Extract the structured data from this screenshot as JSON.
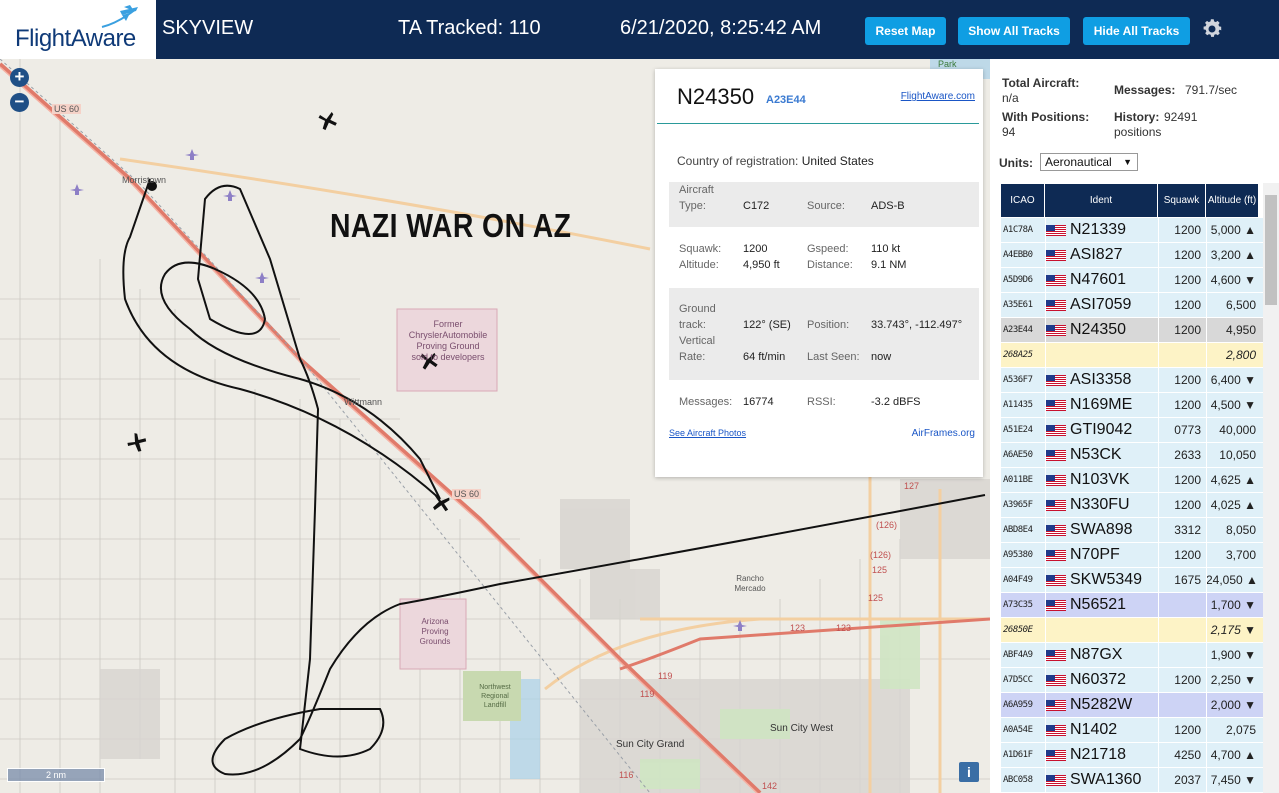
{
  "header": {
    "logo": "FlightAware",
    "app_title": "SKYVIEW",
    "tracked": "TA Tracked: 110",
    "clock": "6/21/2020, 8:25:42 AM",
    "buttons": {
      "reset": "Reset Map",
      "show": "Show All Tracks",
      "hide": "Hide All Tracks"
    }
  },
  "map": {
    "zoom_in": "+",
    "zoom_out": "−",
    "overlay_text": "NAZI WAR ON AZ",
    "scale": "2 nm",
    "info": "i",
    "labels": {
      "us60_a": "US 60",
      "us60_b": "US 60",
      "morristown": "Morristown",
      "wittmann": "Wittmann",
      "chrysler": "Former ChryslerAutomobile Proving Ground sold to developers",
      "arizona_pg": "Arizona Proving Grounds",
      "landfill": "Northwest Regional Landfill",
      "rancho": "Rancho Mercado",
      "sun_city_grand": "Sun City Grand",
      "sun_city_west": "Sun City West",
      "park": "Park",
      "r119a": "119",
      "r119b": "119",
      "r123a": "123",
      "r123b": "123",
      "r125a": "125",
      "r125b": "125",
      "r126a": "(126)",
      "r126b": "(126)",
      "r127": "127",
      "r116": "116",
      "r142": "142"
    }
  },
  "detail": {
    "ident": "N24350",
    "icao": "A23E44",
    "link": "FlightAware.com",
    "country_label": "Country of registration:",
    "country": "United States",
    "aircraft_type_label_1": "Aircraft",
    "aircraft_type_label_2": "Type:",
    "aircraft_type": "C172",
    "source_label": "Source:",
    "source": "ADS-B",
    "squawk_label": "Squawk:",
    "squawk": "1200",
    "altitude_label": "Altitude:",
    "altitude": "4,950 ft",
    "gspeed_label": "Gspeed:",
    "gspeed": "110 kt",
    "distance_label": "Distance:",
    "distance": "9.1 NM",
    "ground_label_1": "Ground",
    "ground_label_2": "track:",
    "ground_track": "122° (SE)",
    "vert_label_1": "Vertical",
    "vert_label_2": "Rate:",
    "vert_rate": "64 ft/min",
    "position_label": "Position:",
    "position": "33.743°, -112.497°",
    "last_seen_label": "Last Seen:",
    "last_seen": "now",
    "messages_label": "Messages:",
    "messages": "16774",
    "rssi_label": "RSSI:",
    "rssi": "-3.2 dBFS",
    "photos": "See Aircraft Photos",
    "airframes": "AirFrames.org"
  },
  "panel": {
    "total_label": "Total Aircraft:",
    "total": "n/a",
    "messages_label": "Messages:",
    "messages": "791.7/sec",
    "positions_label": "With Positions:",
    "positions": "94",
    "history_label": "History:",
    "history_value": "92491",
    "history_unit": "positions",
    "units_label": "Units:",
    "units": "Aeronautical",
    "columns": [
      "ICAO",
      "Ident",
      "Squawk",
      "Altitude (ft)"
    ],
    "rows": [
      {
        "icao": "A1C78A",
        "flag": true,
        "ident": "N21339",
        "squawk": "1200",
        "alt": "5,000 ▲",
        "bg": "#dff0f8"
      },
      {
        "icao": "A4EBB0",
        "flag": true,
        "ident": "ASI827",
        "squawk": "1200",
        "alt": "3,200 ▲",
        "bg": "#dff0f8"
      },
      {
        "icao": "A5D9D6",
        "flag": true,
        "ident": "N47601",
        "squawk": "1200",
        "alt": "4,600 ▼",
        "bg": "#dff0f8"
      },
      {
        "icao": "A35E61",
        "flag": true,
        "ident": "ASI7059",
        "squawk": "1200",
        "alt": "6,500",
        "bg": "#dff0f8"
      },
      {
        "icao": "A23E44",
        "flag": true,
        "ident": "N24350",
        "squawk": "1200",
        "alt": "4,950",
        "bg": "#d8d8d8"
      },
      {
        "icao": "268A25",
        "flag": false,
        "ident": "",
        "squawk": "",
        "alt": "2,800",
        "bg": "#fdf3c6",
        "italic": true
      },
      {
        "icao": "A536F7",
        "flag": true,
        "ident": "ASI3358",
        "squawk": "1200",
        "alt": "6,400 ▼",
        "bg": "#dff0f8"
      },
      {
        "icao": "A11435",
        "flag": true,
        "ident": "N169ME",
        "squawk": "1200",
        "alt": "4,500 ▼",
        "bg": "#dff0f8"
      },
      {
        "icao": "A51E24",
        "flag": true,
        "ident": "GTI9042",
        "squawk": "0773",
        "alt": "40,000",
        "bg": "#dff0f8"
      },
      {
        "icao": "A6AE50",
        "flag": true,
        "ident": "N53CK",
        "squawk": "2633",
        "alt": "10,050",
        "bg": "#dff0f8"
      },
      {
        "icao": "A011BE",
        "flag": true,
        "ident": "N103VK",
        "squawk": "1200",
        "alt": "4,625 ▲",
        "bg": "#dff0f8"
      },
      {
        "icao": "A3965F",
        "flag": true,
        "ident": "N330FU",
        "squawk": "1200",
        "alt": "4,025 ▲",
        "bg": "#dff0f8"
      },
      {
        "icao": "ABD8E4",
        "flag": true,
        "ident": "SWA898",
        "squawk": "3312",
        "alt": "8,050",
        "bg": "#dff0f8"
      },
      {
        "icao": "A95380",
        "flag": true,
        "ident": "N70PF",
        "squawk": "1200",
        "alt": "3,700",
        "bg": "#dff0f8"
      },
      {
        "icao": "A04F49",
        "flag": true,
        "ident": "SKW5349",
        "squawk": "1675",
        "alt": "24,050 ▲",
        "bg": "#dff0f8"
      },
      {
        "icao": "A73C35",
        "flag": true,
        "ident": "N56521",
        "squawk": "",
        "alt": "1,700 ▼",
        "bg": "#cdd3f5"
      },
      {
        "icao": "26850E",
        "flag": false,
        "ident": "",
        "squawk": "",
        "alt": "2,175 ▼",
        "bg": "#fdf3c6",
        "italic": true
      },
      {
        "icao": "ABF4A9",
        "flag": true,
        "ident": "N87GX",
        "squawk": "",
        "alt": "1,900 ▼",
        "bg": "#dff0f8"
      },
      {
        "icao": "A7D5CC",
        "flag": true,
        "ident": "N60372",
        "squawk": "1200",
        "alt": "2,250 ▼",
        "bg": "#dff0f8"
      },
      {
        "icao": "A6A959",
        "flag": true,
        "ident": "N5282W",
        "squawk": "",
        "alt": "2,000 ▼",
        "bg": "#cdd3f5"
      },
      {
        "icao": "A0A54E",
        "flag": true,
        "ident": "N1402",
        "squawk": "1200",
        "alt": "2,075",
        "bg": "#dff0f8"
      },
      {
        "icao": "A1D61F",
        "flag": true,
        "ident": "N21718",
        "squawk": "4250",
        "alt": "4,700 ▲",
        "bg": "#dff0f8"
      },
      {
        "icao": "ABC058",
        "flag": true,
        "ident": "SWA1360",
        "squawk": "2037",
        "alt": "7,450 ▼",
        "bg": "#dff0f8"
      }
    ]
  },
  "colors": {
    "header_bg": "#0e2a54",
    "button_bg": "#0f9ee3",
    "map_bg": "#eeece6",
    "highway": "#e07a6a",
    "track": "#111111",
    "row_blue": "#dff0f8",
    "row_selected": "#d8d8d8",
    "row_yellow": "#fdf3c6",
    "row_lavender": "#cdd3f5"
  }
}
